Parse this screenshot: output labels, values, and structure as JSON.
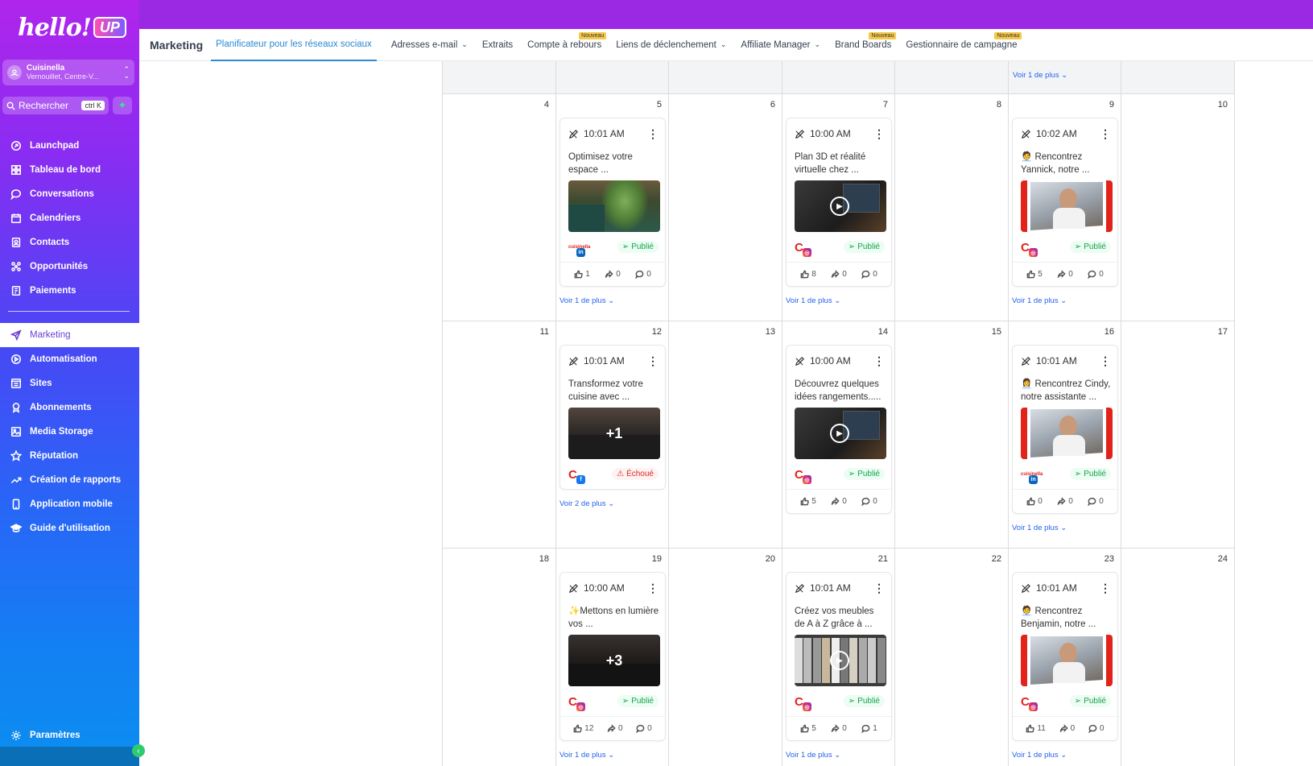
{
  "sidebar": {
    "logo_text": "hello!",
    "logo_badge": "UP",
    "account": {
      "name": "Cuisinella",
      "location": "Vernouillet, Centre-V..."
    },
    "search": {
      "label": "Rechercher",
      "shortcut": "ctrl K"
    },
    "items": [
      {
        "label": "Launchpad",
        "icon": "rocket-icon"
      },
      {
        "label": "Tableau de bord",
        "icon": "dashboard-icon"
      },
      {
        "label": "Conversations",
        "icon": "chat-icon"
      },
      {
        "label": "Calendriers",
        "icon": "calendar-icon"
      },
      {
        "label": "Contacts",
        "icon": "contacts-icon"
      },
      {
        "label": "Opportunités",
        "icon": "opportunities-icon"
      },
      {
        "label": "Paiements",
        "icon": "payments-icon"
      }
    ],
    "items2": [
      {
        "label": "Marketing",
        "icon": "send-icon",
        "active": true
      },
      {
        "label": "Automatisation",
        "icon": "automation-icon"
      },
      {
        "label": "Sites",
        "icon": "sites-icon"
      },
      {
        "label": "Abonnements",
        "icon": "membership-icon"
      },
      {
        "label": "Media Storage",
        "icon": "image-icon"
      },
      {
        "label": "Réputation",
        "icon": "star-icon"
      },
      {
        "label": "Création de rapports",
        "icon": "trend-icon"
      },
      {
        "label": "Application mobile",
        "icon": "mobile-icon"
      },
      {
        "label": "Guide d'utilisation",
        "icon": "graduation-icon"
      }
    ],
    "settings_label": "Paramètres"
  },
  "header": {
    "title": "Marketing",
    "tabs": [
      {
        "label": "Planificateur pour les réseaux sociaux",
        "active": true
      },
      {
        "label": "Adresses e-mail",
        "dropdown": true
      },
      {
        "label": "Extraits"
      },
      {
        "label": "Compte à rebours",
        "badge": "Nouveau"
      },
      {
        "label": "Liens de déclenchement",
        "dropdown": true
      },
      {
        "label": "Affiliate Manager",
        "dropdown": true
      },
      {
        "label": "Brand Boards",
        "badge": "Nouveau"
      },
      {
        "label": "Gestionnaire de campagne",
        "badge": "Nouveau"
      }
    ]
  },
  "calendar": {
    "top_see_more": "Voir 1 de plus",
    "weeks": [
      {
        "days": [
          "4",
          "5",
          "6",
          "7",
          "8",
          "9",
          "10"
        ],
        "see_more": [
          "Voir 1 de plus",
          "Voir 1 de plus",
          "Voir 1 de plus"
        ]
      },
      {
        "days": [
          "11",
          "12",
          "13",
          "14",
          "15",
          "16",
          "17"
        ],
        "see_more": [
          "Voir 2 de plus",
          "",
          "Voir 1 de plus"
        ]
      },
      {
        "days": [
          "18",
          "19",
          "20",
          "21",
          "22",
          "23",
          "24"
        ],
        "see_more": [
          "Voir 1 de plus",
          "Voir 1 de plus",
          "Voir 1 de plus"
        ]
      }
    ],
    "posts": [
      {
        "time": "10:01 AM",
        "caption": "Optimisez votre espace ...",
        "network": "in",
        "logo": "cuisinella",
        "status": "Publié",
        "status_kind": "ok",
        "likes": "1",
        "shares": "0",
        "comments": "0",
        "media": "plant",
        "overlay": ""
      },
      {
        "time": "10:00 AM",
        "caption": "Plan 3D et réalité virtuelle chez ...",
        "network": "ig",
        "logo": "C",
        "status": "Publié",
        "status_kind": "ok",
        "likes": "8",
        "shares": "0",
        "comments": "0",
        "media": "video-dark",
        "overlay": "play"
      },
      {
        "time": "10:02 AM",
        "caption": "🧑‍💼 Rencontrez Yannick, notre ...",
        "network": "ig",
        "logo": "C",
        "status": "Publié",
        "status_kind": "ok",
        "likes": "5",
        "shares": "0",
        "comments": "0",
        "media": "portrait-red",
        "overlay": ""
      },
      {
        "time": "10:01 AM",
        "caption": "Transformez votre cuisine avec ...",
        "network": "fb",
        "logo": "C",
        "status": "Échoué",
        "status_kind": "fail",
        "likes": "",
        "shares": "",
        "comments": "",
        "media": "kitchen",
        "overlay": "+1"
      },
      {
        "time": "10:00 AM",
        "caption": "Découvrez quelques idées rangements.....",
        "network": "ig",
        "logo": "C",
        "status": "Publié",
        "status_kind": "ok",
        "likes": "5",
        "shares": "0",
        "comments": "0",
        "media": "video-dark",
        "overlay": "play"
      },
      {
        "time": "10:01 AM",
        "caption": "👩‍💼 Rencontrez Cindy, notre assistante ...",
        "network": "in",
        "logo": "cuisinella",
        "status": "Publié",
        "status_kind": "ok",
        "likes": "0",
        "shares": "0",
        "comments": "0",
        "media": "portrait-red",
        "overlay": ""
      },
      {
        "time": "10:00 AM",
        "caption": "✨Mettons en lumière vos ...",
        "network": "ig",
        "logo": "C",
        "status": "Publié",
        "status_kind": "ok",
        "likes": "12",
        "shares": "0",
        "comments": "0",
        "media": "kitchen-dark",
        "overlay": "+3"
      },
      {
        "time": "10:01 AM",
        "caption": "Créez vos meubles de A à Z grâce à ...",
        "network": "ig",
        "logo": "C",
        "status": "Publié",
        "status_kind": "ok",
        "likes": "5",
        "shares": "0",
        "comments": "1",
        "media": "samples",
        "overlay": "play"
      },
      {
        "time": "10:01 AM",
        "caption": "🧑‍💼 Rencontrez Benjamin, notre ...",
        "network": "ig",
        "logo": "C",
        "status": "Publié",
        "status_kind": "ok",
        "likes": "11",
        "shares": "0",
        "comments": "0",
        "media": "portrait-red",
        "overlay": ""
      }
    ]
  },
  "colors": {
    "accent": "#2a8ad4",
    "brand_red": "#e2231a",
    "success": "#16a34a",
    "danger": "#dc2626",
    "link": "#2563eb"
  }
}
